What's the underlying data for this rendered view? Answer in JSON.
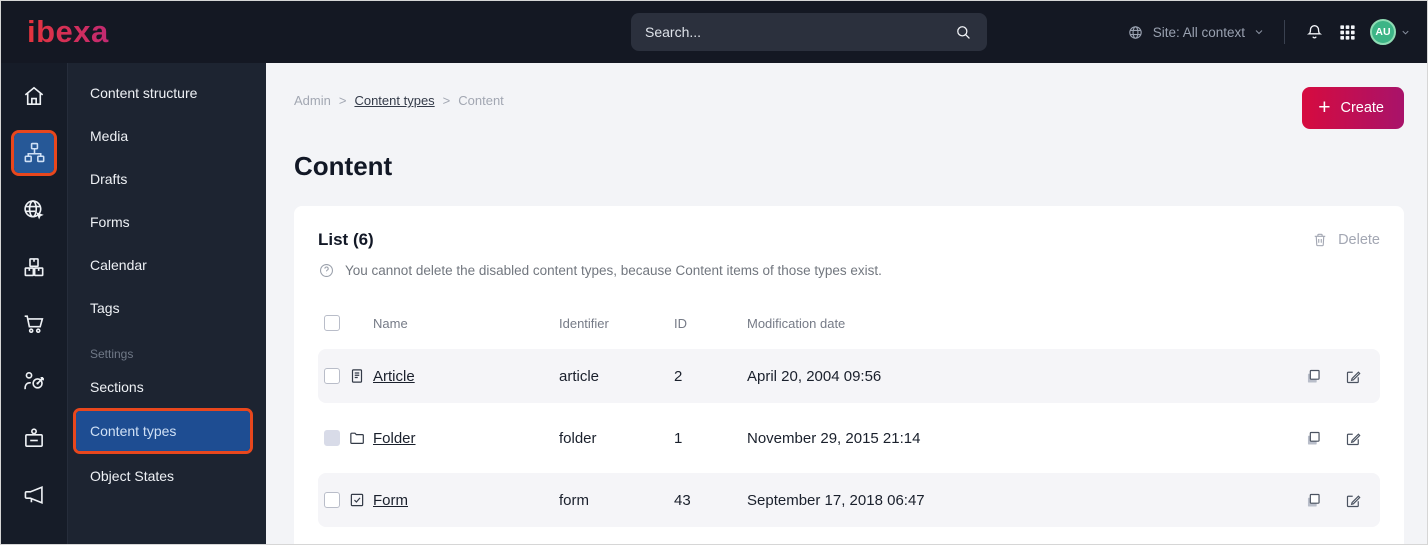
{
  "topbar": {
    "logo_text": "ibexa",
    "search_placeholder": "Search...",
    "site_selector_label": "Site: All context",
    "avatar_initials": "AU"
  },
  "iconbar": {
    "items": [
      {
        "icon": "home-icon"
      },
      {
        "icon": "content-structure-icon",
        "active": true,
        "annotated": true
      },
      {
        "icon": "site-globe-icon"
      },
      {
        "icon": "storage-boxes-icon"
      },
      {
        "icon": "commerce-cart-icon"
      },
      {
        "icon": "personalization-target-icon"
      },
      {
        "icon": "admin-badge-icon"
      },
      {
        "icon": "promote-megaphone-icon"
      }
    ]
  },
  "sidebar": {
    "items": [
      {
        "label": "Content structure"
      },
      {
        "label": "Media"
      },
      {
        "label": "Drafts"
      },
      {
        "label": "Forms"
      },
      {
        "label": "Calendar"
      },
      {
        "label": "Tags"
      }
    ],
    "settings_label": "Settings",
    "settings_items": [
      {
        "label": "Sections"
      },
      {
        "label": "Content types",
        "active": true,
        "annotated": true
      },
      {
        "label": "Object States"
      }
    ]
  },
  "main": {
    "breadcrumb": [
      "Admin",
      "Content types",
      "Content"
    ],
    "breadcrumb_separator": ">",
    "create_label": "Create",
    "create_plus": "+",
    "title": "Content",
    "list": {
      "heading": "List (6)",
      "info_text": "You cannot delete the disabled content types, because Content items of those types exist.",
      "delete_label": "Delete",
      "columns": [
        "Name",
        "Identifier",
        "ID",
        "Modification date"
      ],
      "rows": [
        {
          "name": "Article",
          "identifier": "article",
          "id": "2",
          "modified": "April 20, 2004 09:56",
          "type_icon": "article-icon",
          "checkbox_disabled": false
        },
        {
          "name": "Folder",
          "identifier": "folder",
          "id": "1",
          "modified": "November 29, 2015 21:14",
          "type_icon": "folder-icon",
          "checkbox_disabled": true
        },
        {
          "name": "Form",
          "identifier": "form",
          "id": "43",
          "modified": "September 17, 2018 06:47",
          "type_icon": "form-icon",
          "checkbox_disabled": false
        }
      ]
    }
  },
  "colors": {
    "accent_orange": "#e8471d",
    "active_blue": "#265897",
    "active_item_blue": "#1e4d92",
    "topbar_bg": "#141823",
    "iconbar_bg": "#161c28",
    "menubar_bg": "#1d2431",
    "main_bg": "#f3f4f7",
    "card_bg": "#ffffff",
    "row_stripe": "#f5f5f8",
    "create_start": "#d60b3f",
    "create_end": "#a8136a",
    "logo_start": "#f0372b",
    "logo_end": "#c22a72",
    "avatar_green": "#3cb586"
  }
}
